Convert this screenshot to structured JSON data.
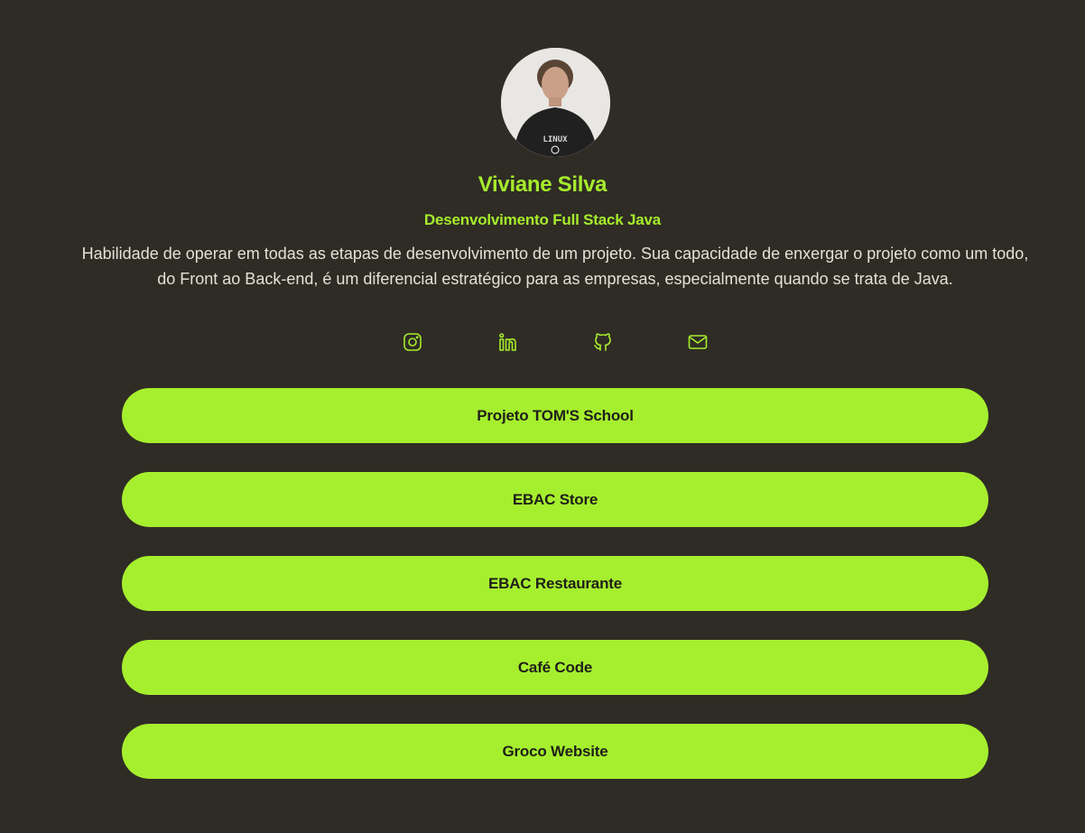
{
  "profile": {
    "name": "Viviane Silva",
    "role": "Desenvolvimento Full Stack Java",
    "bio": "Habilidade de operar em todas as etapas de desenvolvimento de um projeto. Sua capacidade de enxergar o projeto como um todo, do Front ao Back-end, é um diferencial estratégico para as empresas, especialmente quando se trata de Java.",
    "avatar_icon": "profile-photo",
    "shirt_text": "LINUX"
  },
  "socials": [
    {
      "icon": "instagram-icon"
    },
    {
      "icon": "linkedin-icon"
    },
    {
      "icon": "github-icon"
    },
    {
      "icon": "mail-icon"
    }
  ],
  "links": [
    {
      "label": "Projeto TOM'S School"
    },
    {
      "label": "EBAC Store"
    },
    {
      "label": "EBAC Restaurante"
    },
    {
      "label": "Café Code"
    },
    {
      "label": "Groco Website"
    }
  ],
  "colors": {
    "background": "#2f2c25",
    "accent": "#a6ec2c",
    "button_text": "#1f1f19",
    "text": "#e4e1d9"
  }
}
